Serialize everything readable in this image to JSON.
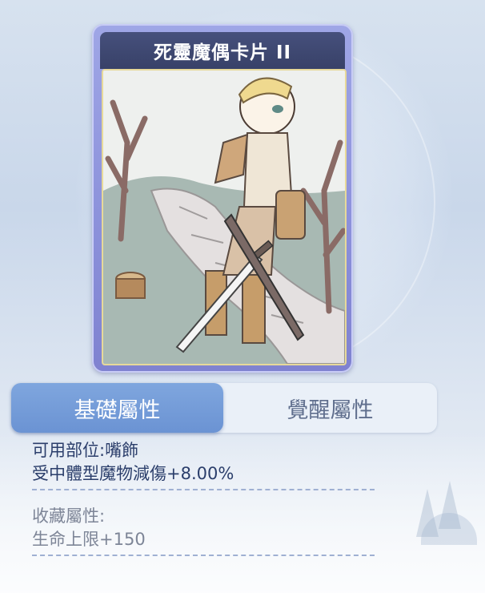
{
  "card": {
    "title": "死靈魔偶卡片 II"
  },
  "tabs": [
    {
      "label": "基礎屬性",
      "active": true
    },
    {
      "label": "覺醒屬性",
      "active": false
    }
  ],
  "base_attributes": {
    "slot_line": "可用部位:嘴飾",
    "effect_line": "受中體型魔物減傷+8.00%"
  },
  "collection_attributes": {
    "header": "收藏屬性:",
    "effect_line": "生命上限+150"
  },
  "colors": {
    "tab_active": "#6b93d3",
    "card_frame": "#8b90da",
    "card_title_bar": "#3f4872",
    "text_primary": "#2b3e6b",
    "text_muted": "#7d8597"
  }
}
